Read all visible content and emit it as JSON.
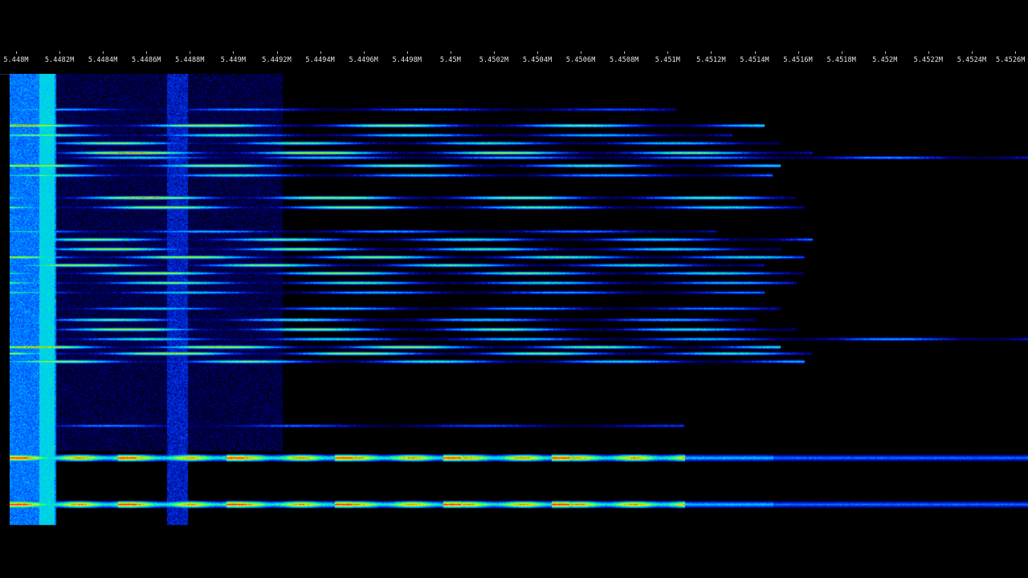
{
  "freq_scale": {
    "ticks": [
      {
        "label": "5.448M"
      },
      {
        "label": "5.4482M"
      },
      {
        "label": "5.4484M"
      },
      {
        "label": "5.4486M"
      },
      {
        "label": "5.4488M"
      },
      {
        "label": "5.449M"
      },
      {
        "label": "5.4492M"
      },
      {
        "label": "5.4494M"
      },
      {
        "label": "5.4496M"
      },
      {
        "label": "5.4498M"
      },
      {
        "label": "5.45M"
      },
      {
        "label": "5.4502M"
      },
      {
        "label": "5.4504M"
      },
      {
        "label": "5.4506M"
      },
      {
        "label": "5.4508M"
      },
      {
        "label": "5.451M"
      },
      {
        "label": "5.4512M"
      },
      {
        "label": "5.4514M"
      },
      {
        "label": "5.4516M"
      },
      {
        "label": "5.4518M"
      },
      {
        "label": "5.452M"
      },
      {
        "label": "5.4522M"
      },
      {
        "label": "5.4524M"
      },
      {
        "label": "5.4526M"
      }
    ]
  },
  "waterfall": {
    "palette": [
      "#000000",
      "#00007a",
      "#0040ff",
      "#00c8ff",
      "#00ff80",
      "#c8ff00",
      "#ffd000",
      "#ff2020",
      "#ff00c8"
    ]
  }
}
